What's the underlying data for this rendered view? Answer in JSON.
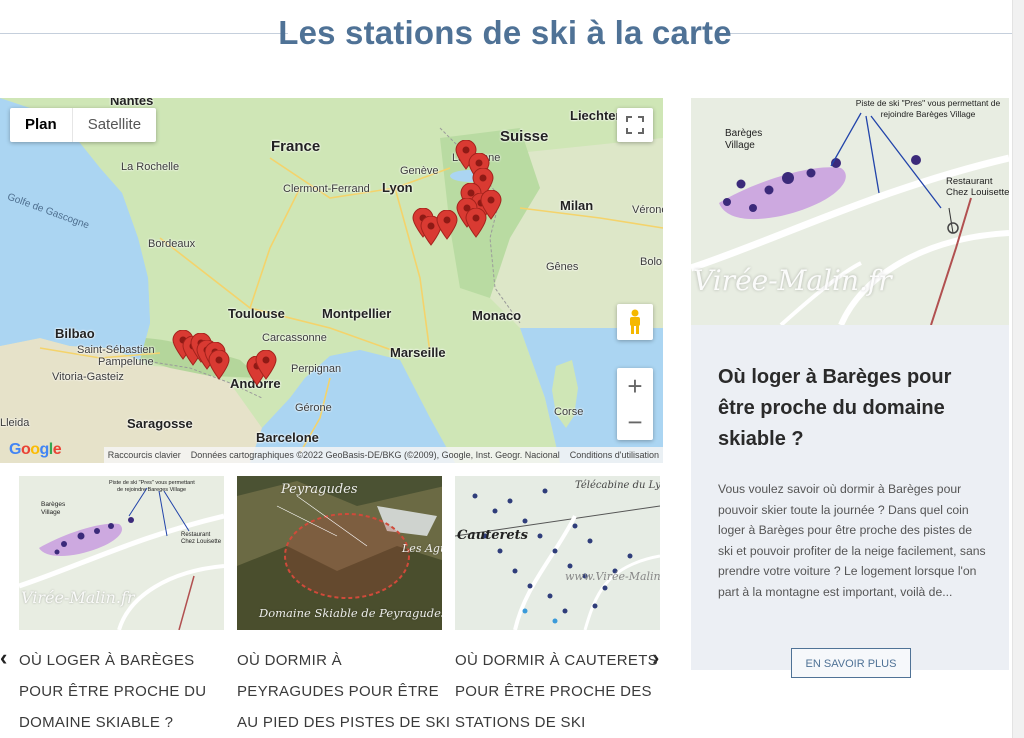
{
  "page": {
    "title": "Les stations de ski à la carte"
  },
  "map": {
    "maptype_plan": "Plan",
    "maptype_satellite": "Satellite",
    "zoom_in": "+",
    "zoom_out": "−",
    "logo": "Google",
    "attribution": {
      "shortcuts": "Raccourcis clavier",
      "data": "Données cartographiques ©2022 GeoBasis-DE/BKG (©2009), Google, Inst. Geogr. Nacional",
      "terms": "Conditions d'utilisation"
    },
    "labels": {
      "nantes": "Nantes",
      "liechtenstein": "Liechtenst",
      "france": "France",
      "suisse": "Suisse",
      "la_rochelle": "La Rochelle",
      "geneve": "Genève",
      "lausanne": "Lausanne",
      "clermont": "Clermont-Ferrand",
      "lyon": "Lyon",
      "milan": "Milan",
      "verone": "Vérone",
      "golfe": "Golfe de Gascogne",
      "bordeaux": "Bordeaux",
      "genes": "Gênes",
      "bolo": "Bolo",
      "toulouse": "Toulouse",
      "montpellier": "Montpellier",
      "monaco": "Monaco",
      "bilbao": "Bilbao",
      "carcassonne": "Carcassonne",
      "saint_sebastien": "Saint-Sébastien",
      "pampelune": "Pampelune",
      "marseille": "Marseille",
      "vitoria": "Vitoria-Gasteiz",
      "perpignan": "Perpignan",
      "andorre": "Andorre",
      "corse": "Corse",
      "saragosse": "Saragosse",
      "gerone": "Gérone",
      "barcelone": "Barcelone",
      "leida": "Lleida"
    }
  },
  "carousel": {
    "items": [
      {
        "caption": "Où loger à Barèges pour être proche du domaine skiable ?",
        "watermark": "Virée-Malin.fr"
      },
      {
        "caption": "Où dormir à Peyragudes pour être au pied des pistes de ski",
        "watermark": "Domaine Skiable de Peyragudes",
        "img_title": "Peyragudes",
        "img_sub": "Les Agudes"
      },
      {
        "caption": "Où dormir à Cauterets pour être proche des stations de ski",
        "watermark": "www.Virée-Malin",
        "img_title": "Cauterets",
        "img_sub": "Télécabine du Lys"
      }
    ],
    "prev": "‹",
    "next": "›"
  },
  "card": {
    "image_labels": {
      "pistes": "Piste de ski \"Pres\" vous permettant de rejoindre Barèges Village",
      "bareges": "Barèges Village",
      "restaurant": "Restaurant Chez Louisette",
      "watermark": "Virée-Malin.fr"
    },
    "title": "Où loger à Barèges pour être proche du domaine skiable ?",
    "text": "Vous voulez savoir où dormir à Barèges pour pouvoir skier toute la journée ? Dans quel coin loger à Barèges pour être proche des pistes de ski et pouvoir profiter de la neige facilement, sans prendre votre voiture ? Le logement lorsque l'on part à la montagne est important, voilà de...",
    "button": "EN SAVOIR PLUS"
  },
  "colors": {
    "accent": "#4f7296",
    "marker": "#d93a32",
    "water": "#abd5f2",
    "land": "#cde5b8"
  }
}
